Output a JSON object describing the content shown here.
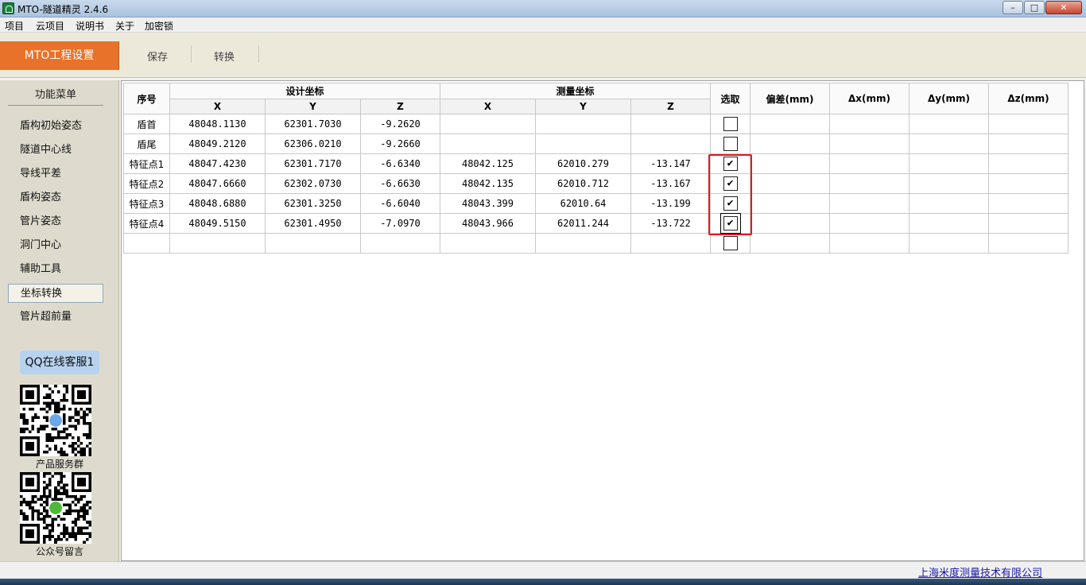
{
  "window": {
    "title": "MTO-隧道精灵 2.4.6"
  },
  "menubar": {
    "items": [
      "项目",
      "云项目",
      "说明书",
      "关于",
      "加密锁"
    ]
  },
  "toolbar": {
    "project_settings": "MTO工程设置",
    "save": "保存",
    "convert": "转换"
  },
  "sidebar": {
    "title": "功能菜单",
    "items": [
      "盾构初始姿态",
      "隧道中心线",
      "导线平差",
      "盾构姿态",
      "管片姿态",
      "洞门中心",
      "辅助工具",
      "坐标转换",
      "管片超前量"
    ],
    "active_item": "坐标转换",
    "qq_button": "QQ在线客服1",
    "qr1_caption": "产品服务群",
    "qr2_caption": "公众号留言"
  },
  "grid": {
    "headers": {
      "index": "序号",
      "design": "设计坐标",
      "measured": "测量坐标",
      "select": "选取",
      "deviation": "偏差(mm)",
      "dx": "Δx(mm)",
      "dy": "Δy(mm)",
      "dz": "Δz(mm)",
      "x": "X",
      "y": "Y",
      "z": "Z"
    },
    "rows": [
      {
        "name": "盾首",
        "dx": "48048.1130",
        "dy": "62301.7030",
        "dz": "-9.2620",
        "mx": "",
        "my": "",
        "mz": "",
        "checked": false
      },
      {
        "name": "盾尾",
        "dx": "48049.2120",
        "dy": "62306.0210",
        "dz": "-9.2660",
        "mx": "",
        "my": "",
        "mz": "",
        "checked": false
      },
      {
        "name": "特征点1",
        "dx": "48047.4230",
        "dy": "62301.7170",
        "dz": "-6.6340",
        "mx": "48042.125",
        "my": "62010.279",
        "mz": "-13.147",
        "checked": true
      },
      {
        "name": "特征点2",
        "dx": "48047.6660",
        "dy": "62302.0730",
        "dz": "-6.6630",
        "mx": "48042.135",
        "my": "62010.712",
        "mz": "-13.167",
        "checked": true
      },
      {
        "name": "特征点3",
        "dx": "48048.6880",
        "dy": "62301.3250",
        "dz": "-6.6040",
        "mx": "48043.399",
        "my": "62010.64",
        "mz": "-13.199",
        "checked": true
      },
      {
        "name": "特征点4",
        "dx": "48049.5150",
        "dy": "62301.4950",
        "dz": "-7.0970",
        "mx": "48043.966",
        "my": "62011.244",
        "mz": "-13.722",
        "checked": true
      },
      {
        "name": "",
        "dx": "",
        "dy": "",
        "dz": "",
        "mx": "",
        "my": "",
        "mz": "",
        "checked": false
      }
    ],
    "check_mark": "✔"
  },
  "statusbar": {
    "company": "上海米度测量技术有限公司"
  },
  "colors": {
    "accent": "#e8722a",
    "highlight": "#e0191e",
    "link": "#1a1aa6"
  }
}
